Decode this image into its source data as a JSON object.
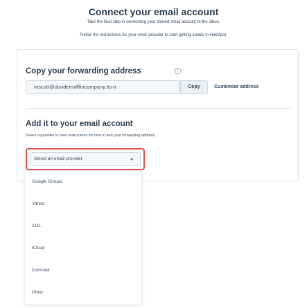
{
  "header": {
    "title": "Connect your email account",
    "subtitle": "Take the final step in connecting your shared email account to the inbox.",
    "instructions": "Follow the instructions for your email provider to start getting emails in HubSpot."
  },
  "forwarding": {
    "title": "Copy your forwarding address",
    "address": "mscott@dundermifflincompany.hs-ir",
    "copy_label": "Copy",
    "customize_label": "Customize address"
  },
  "add_section": {
    "title": "Add it to your email account",
    "description": "Select a provider to view instructions for how to add your forwarding address.",
    "select_placeholder": "Select an email provider"
  },
  "dropdown": {
    "options": [
      "Google Groups",
      "Yahoo",
      "AOL",
      "iCloud",
      "Comcast",
      "Other"
    ]
  },
  "colors": {
    "highlight": "#d9534f",
    "text": "#33475b"
  }
}
